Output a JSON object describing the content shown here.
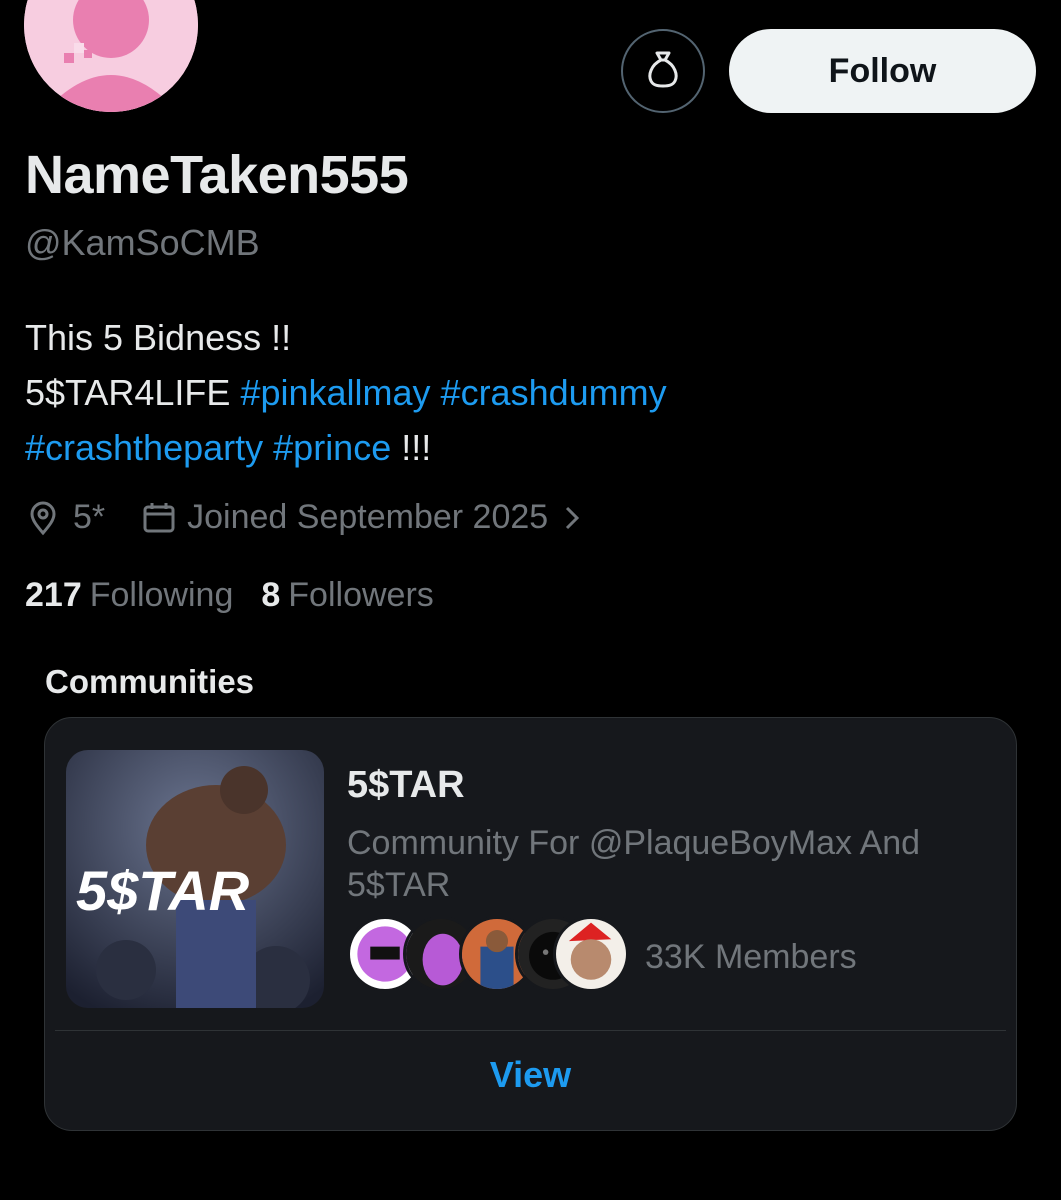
{
  "profile": {
    "display_name": "NameTaken555",
    "handle": "@KamSoCMB",
    "bio_line1": "This 5 Bidness !!",
    "bio_line2_text": "5$TAR4LIFE",
    "bio_tag1": "#pinkallmay",
    "bio_tag2": "#crashdummy",
    "bio_tag3": "#crashtheparty",
    "bio_tag4": "#prince",
    "bio_end": "!!!",
    "location": "5*",
    "joined": "Joined September 2025",
    "following_count": "217",
    "following_label": "Following",
    "followers_count": "8",
    "followers_label": "Followers"
  },
  "actions": {
    "follow_label": "Follow",
    "tip_icon": "money-bag-icon"
  },
  "communities": {
    "title": "Communities",
    "items": [
      {
        "name": "5$TAR",
        "description": "Community For @PlaqueBoyMax And 5$TAR",
        "members": "33K Members",
        "view_label": "View",
        "image_text": "5$TAR"
      }
    ]
  },
  "colors": {
    "background": "#000000",
    "text_primary": "#e7e9ea",
    "text_secondary": "#71767b",
    "link": "#1d9bf0",
    "button_bg": "#eff3f4"
  }
}
